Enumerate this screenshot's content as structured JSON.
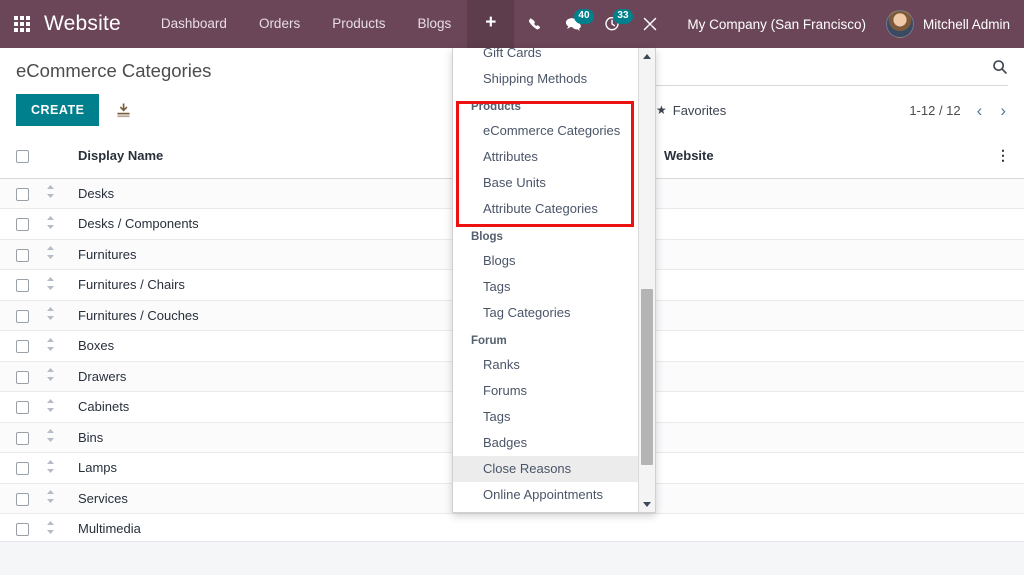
{
  "navbar": {
    "apps_icon": "apps-grid-icon",
    "brand": "Website",
    "menu": [
      {
        "label": "Dashboard"
      },
      {
        "label": "Orders"
      },
      {
        "label": "Products"
      },
      {
        "label": "Blogs"
      }
    ],
    "plus_label": "+",
    "icons": [
      {
        "name": "phone-icon",
        "badge": null
      },
      {
        "name": "messages-icon",
        "badge": "40"
      },
      {
        "name": "activities-icon",
        "badge": "33"
      },
      {
        "name": "debug-tools-icon",
        "badge": null
      }
    ],
    "company": "My Company (San Francisco)",
    "user_name": "Mitchell Admin",
    "accent": "#6b4658",
    "badge_color": "#00808c"
  },
  "control_panel": {
    "page_title": "eCommerce Categories",
    "create_label": "CREATE",
    "create_color": "#00808c",
    "import_icon": "import-download-icon",
    "search_icon": "search-icon",
    "search_placeholder": "",
    "search_value": "",
    "favorites_label": "Favorites",
    "favorites_icon": "star-icon",
    "pager_label": "1-12 / 12",
    "pager_prev_icon": "chevron-left-icon",
    "pager_next_icon": "chevron-right-icon"
  },
  "table": {
    "columns": [
      "Display Name",
      "Website"
    ],
    "header_select_all_icon": "checkbox-icon",
    "options_icon": "vertical-dots-icon",
    "rows": [
      {
        "display_name": "Desks",
        "website": ""
      },
      {
        "display_name": "Desks / Components",
        "website": ""
      },
      {
        "display_name": "Furnitures",
        "website": ""
      },
      {
        "display_name": "Furnitures / Chairs",
        "website": ""
      },
      {
        "display_name": "Furnitures / Couches",
        "website": ""
      },
      {
        "display_name": "Boxes",
        "website": ""
      },
      {
        "display_name": "Drawers",
        "website": ""
      },
      {
        "display_name": "Cabinets",
        "website": ""
      },
      {
        "display_name": "Bins",
        "website": ""
      },
      {
        "display_name": "Lamps",
        "website": ""
      },
      {
        "display_name": "Services",
        "website": ""
      },
      {
        "display_name": "Multimedia",
        "website": ""
      }
    ]
  },
  "dropdown": {
    "groups": [
      {
        "section": null,
        "items": [
          {
            "label": "Gift Cards",
            "hovered": false
          },
          {
            "label": "Shipping Methods",
            "hovered": false
          }
        ]
      },
      {
        "section": "Products",
        "highlighted": true,
        "items": [
          {
            "label": "eCommerce Categories",
            "hovered": false
          },
          {
            "label": "Attributes",
            "hovered": false
          },
          {
            "label": "Base Units",
            "hovered": false
          },
          {
            "label": "Attribute Categories",
            "hovered": false
          }
        ]
      },
      {
        "section": "Blogs",
        "items": [
          {
            "label": "Blogs",
            "hovered": false
          },
          {
            "label": "Tags",
            "hovered": false
          },
          {
            "label": "Tag Categories",
            "hovered": false
          }
        ]
      },
      {
        "section": "Forum",
        "items": [
          {
            "label": "Ranks",
            "hovered": false
          },
          {
            "label": "Forums",
            "hovered": false
          },
          {
            "label": "Tags",
            "hovered": false
          },
          {
            "label": "Badges",
            "hovered": false
          },
          {
            "label": "Close Reasons",
            "hovered": true
          },
          {
            "label": "Online Appointments",
            "hovered": false
          }
        ]
      }
    ],
    "scroll_up_icon": "scroll-up-arrow-icon",
    "scroll_down_icon": "scroll-down-arrow-icon",
    "highlight_color": "#ee1111"
  }
}
